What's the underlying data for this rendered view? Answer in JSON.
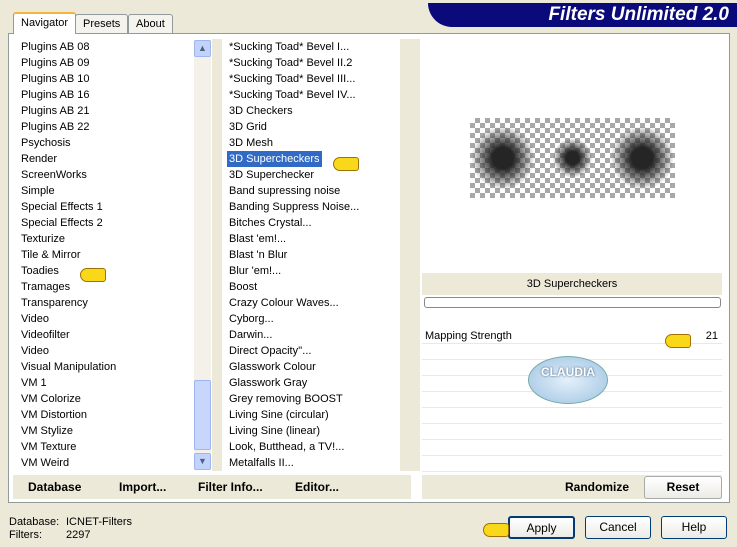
{
  "title": "Filters Unlimited 2.0",
  "tabs": [
    "Navigator",
    "Presets",
    "About"
  ],
  "categories": [
    "Plugins AB 08",
    "Plugins AB 09",
    "Plugins AB 10",
    "Plugins AB 16",
    "Plugins AB 21",
    "Plugins AB 22",
    "Psychosis",
    "Render",
    "ScreenWorks",
    "Simple",
    "Special Effects 1",
    "Special Effects 2",
    "Texturize",
    "Tile & Mirror",
    "Toadies",
    "Tramages",
    "Transparency",
    "Video",
    "Videofilter",
    "Video",
    "Visual Manipulation",
    "VM 1",
    "VM Colorize",
    "VM Distortion",
    "VM Stylize",
    "VM Texture",
    "VM Weird"
  ],
  "filters": [
    "*Sucking Toad*  Bevel I...",
    "*Sucking Toad*  Bevel II.2",
    "*Sucking Toad*  Bevel III...",
    "*Sucking Toad*  Bevel IV...",
    "3D Checkers",
    "3D Grid",
    "3D Mesh",
    "3D Supercheckers",
    "3D Superchecker",
    "Band supressing noise",
    "Banding Suppress Noise...",
    "Bitches Crystal...",
    "Blast 'em!...",
    "Blast 'n Blur",
    "Blur 'em!...",
    "Boost",
    "Crazy Colour Waves...",
    "Cyborg...",
    "Darwin...",
    "Direct Opacity''...",
    "Glasswork Colour",
    "Glasswork Gray",
    "Grey removing BOOST",
    "Living Sine (circular)",
    "Living Sine (linear)",
    "Look, Butthead, a TV!...",
    "Metalfalls II..."
  ],
  "selected_filter_index": 7,
  "bottom_buttons": {
    "database": "Database",
    "import": "Import...",
    "filter_info": "Filter Info...",
    "editor": "Editor..."
  },
  "preview_title": "3D Supercheckers",
  "params": [
    {
      "label": "Mapping Strength",
      "value": "21"
    }
  ],
  "watermark": "CLAUDIA",
  "randomize": "Randomize",
  "reset": "Reset",
  "info": {
    "database_label": "Database:",
    "database_value": "ICNET-Filters",
    "filters_label": "Filters:",
    "filters_value": "2297"
  },
  "actions": {
    "apply": "Apply",
    "cancel": "Cancel",
    "help": "Help"
  },
  "accent": "#0a0a7a",
  "selection": "#316ac5"
}
